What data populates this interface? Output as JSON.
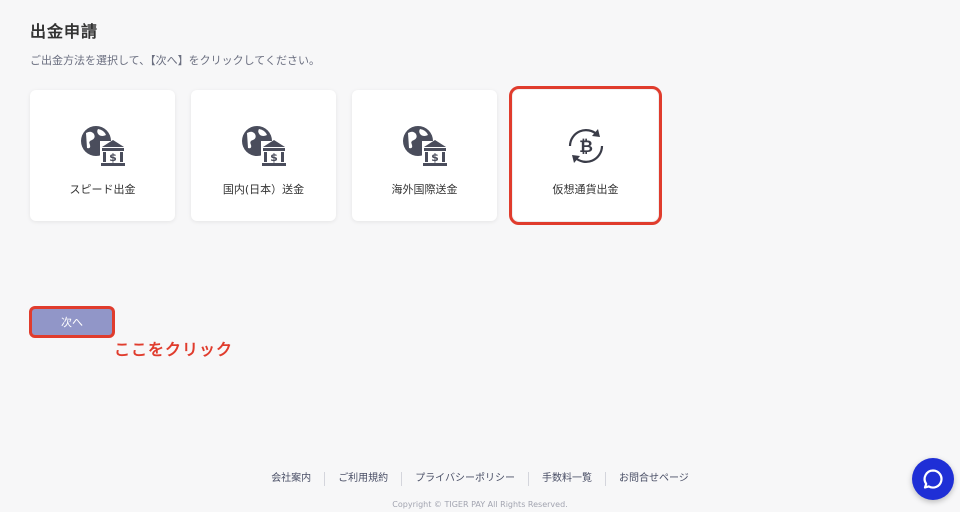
{
  "page": {
    "title": "出金申請",
    "subtitle": "ご出金方法を選択して、【次へ】をクリックしてください。"
  },
  "methods": [
    {
      "label": "スピード出金",
      "icon": "globe-bank-icon"
    },
    {
      "label": "国内(日本）送金",
      "icon": "globe-bank-icon"
    },
    {
      "label": "海外国際送金",
      "icon": "globe-bank-icon"
    },
    {
      "label": "仮想通貨出金",
      "icon": "bitcoin-exchange-icon",
      "selected": true
    }
  ],
  "next_button": {
    "label": "次へ"
  },
  "annotation": "ここをクリック",
  "footer": {
    "links": [
      "会社案内",
      "ご利用規約",
      "プライバシーポリシー",
      "手数料一覧",
      "お問合せページ"
    ],
    "copyright": "Copyright © TIGER PAY All Rights Reserved."
  },
  "colors": {
    "accent": "#9196c8",
    "highlight": "#e03c2d",
    "chat": "#1f2fd6"
  }
}
